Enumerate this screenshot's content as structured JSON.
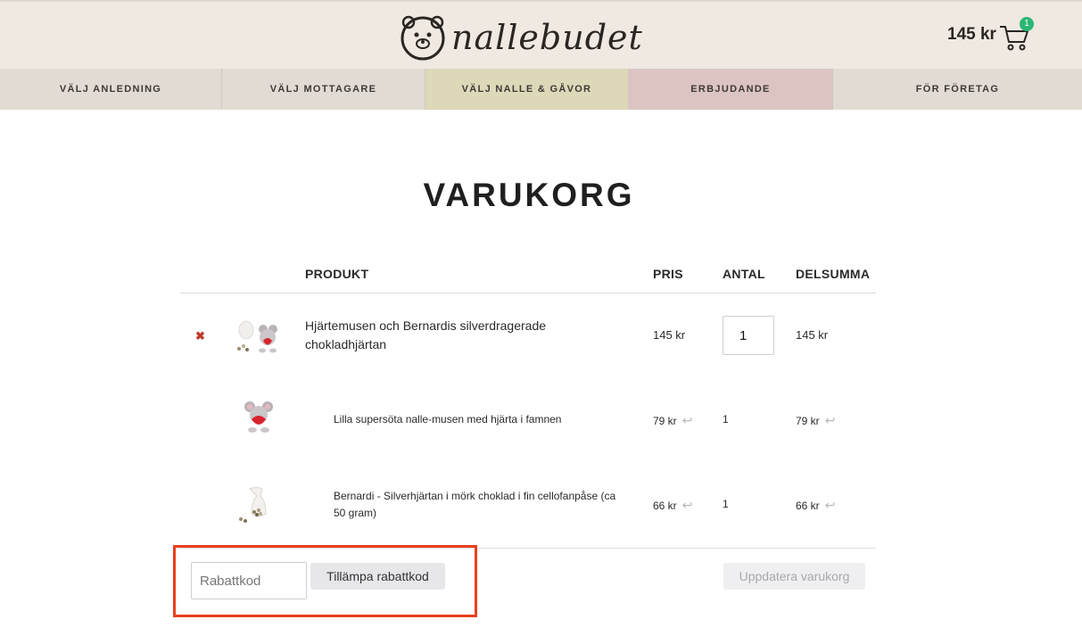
{
  "header": {
    "logo_text": "nallebudet",
    "cart_total": "145 kr",
    "cart_count": "1"
  },
  "nav": {
    "items": [
      {
        "label": "VÄLJ ANLEDNING"
      },
      {
        "label": "VÄLJ MOTTAGARE"
      },
      {
        "label": "VÄLJ NALLE & GÅVOR"
      },
      {
        "label": "ERBJUDANDE"
      },
      {
        "label": "FÖR FÖRETAG"
      }
    ]
  },
  "page": {
    "title": "VARUKORG"
  },
  "table": {
    "headers": {
      "product": "PRODUKT",
      "price": "PRIS",
      "quantity": "ANTAL",
      "subtotal": "DELSUMMA"
    },
    "rows": [
      {
        "name": "Hjärtemusen och Bernardis silverdragerade chokladhjärtan",
        "price": "145 kr",
        "quantity": "1",
        "subtotal": "145 kr"
      },
      {
        "name": "Lilla supersöta nalle-musen med hjärta i famnen",
        "price": "79 kr",
        "quantity": "1",
        "subtotal": "79 kr"
      },
      {
        "name": "Bernardi - Silverhjärtan i mörk choklad i fin cellofanpåse (ca 50 gram)",
        "price": "66 kr",
        "quantity": "1",
        "subtotal": "66 kr"
      }
    ]
  },
  "actions": {
    "coupon_placeholder": "Rabattkod",
    "apply_label": "Tillämpa rabattkod",
    "update_label": "Uppdatera varukorg"
  },
  "colors": {
    "badge": "#2bb673",
    "highlight": "#e8411e",
    "remove": "#c0392b"
  }
}
